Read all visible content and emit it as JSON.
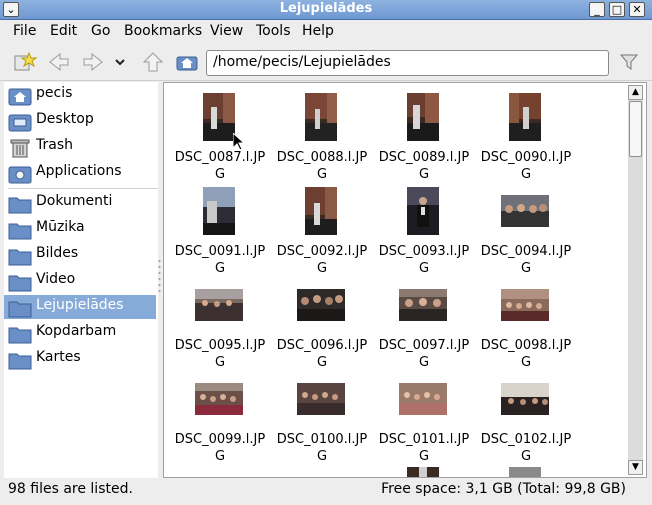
{
  "window": {
    "title": "Lejupielādes",
    "minimize_glyph": "_",
    "maximize_glyph": "□",
    "close_glyph": "✕",
    "menu_glyph": "⌄"
  },
  "menubar": {
    "items": [
      "File",
      "Edit",
      "Go",
      "Bookmarks",
      "View",
      "Tools",
      "Help"
    ]
  },
  "toolbar": {
    "icons": [
      "new-bookmark-icon",
      "back-icon",
      "forward-icon",
      "history-dropdown-icon",
      "up-icon",
      "home-icon",
      "filter-icon"
    ],
    "location": "/home/pecis/Lejupielādes"
  },
  "sidebar": {
    "places": [
      {
        "label": "pecis",
        "icon": "home-folder-icon"
      },
      {
        "label": "Desktop",
        "icon": "desktop-icon"
      },
      {
        "label": "Trash",
        "icon": "trash-icon"
      },
      {
        "label": "Applications",
        "icon": "applications-icon"
      }
    ],
    "bookmarks": [
      {
        "label": "Dokumenti",
        "icon": "folder-icon"
      },
      {
        "label": "Mūzika",
        "icon": "folder-icon"
      },
      {
        "label": "Bildes",
        "icon": "folder-icon"
      },
      {
        "label": "Video",
        "icon": "folder-icon"
      },
      {
        "label": "Lejupielādes",
        "icon": "folder-icon",
        "selected": true
      },
      {
        "label": "Kopdarbam",
        "icon": "folder-icon"
      },
      {
        "label": "Kartes",
        "icon": "folder-icon"
      }
    ]
  },
  "files": [
    {
      "name": "DSC_0087.l.JPG",
      "orientation": "portrait"
    },
    {
      "name": "DSC_0088.l.JPG",
      "orientation": "portrait"
    },
    {
      "name": "DSC_0089.l.JPG",
      "orientation": "portrait"
    },
    {
      "name": "DSC_0090.l.JPG",
      "orientation": "portrait"
    },
    {
      "name": "DSC_0091.l.JPG",
      "orientation": "portrait"
    },
    {
      "name": "DSC_0092.l.JPG",
      "orientation": "portrait"
    },
    {
      "name": "DSC_0093.l.JPG",
      "orientation": "portrait"
    },
    {
      "name": "DSC_0094.l.JPG",
      "orientation": "landscape"
    },
    {
      "name": "DSC_0095.l.JPG",
      "orientation": "landscape"
    },
    {
      "name": "DSC_0096.l.JPG",
      "orientation": "landscape"
    },
    {
      "name": "DSC_0097.l.JPG",
      "orientation": "landscape"
    },
    {
      "name": "DSC_0098.l.JPG",
      "orientation": "landscape"
    },
    {
      "name": "DSC_0099.l.JPG",
      "orientation": "landscape"
    },
    {
      "name": "DSC_0100.l.JPG",
      "orientation": "landscape"
    },
    {
      "name": "DSC_0101.l.JPG",
      "orientation": "landscape"
    },
    {
      "name": "DSC_0102.l.JPG",
      "orientation": "landscape"
    }
  ],
  "statusbar": {
    "left": "98 files are listed.",
    "right": "Free space: 3,1 GB (Total: 99,8 GB)"
  },
  "colors": {
    "titlebar": "#7ba3d8",
    "selection": "#86abd9",
    "folder": "#6a8fc7"
  }
}
